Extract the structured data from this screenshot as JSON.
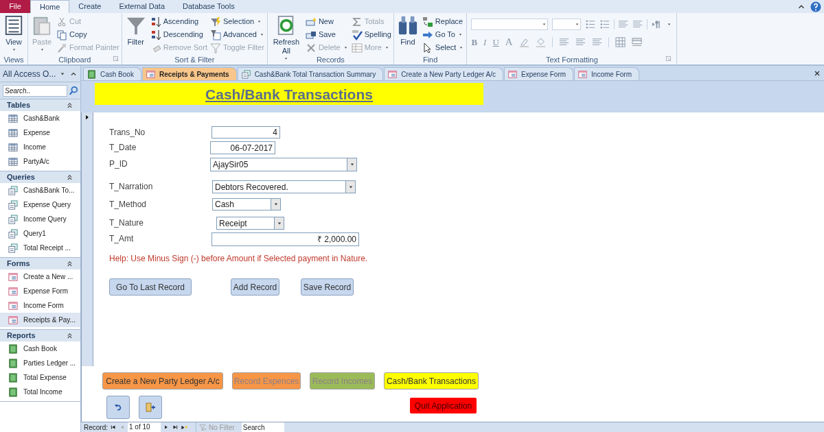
{
  "ribbon": {
    "tabs": [
      {
        "label": "File",
        "kind": "file",
        "selected": false
      },
      {
        "label": "Home",
        "kind": "tab",
        "selected": true
      },
      {
        "label": "Create",
        "kind": "tab",
        "selected": false
      },
      {
        "label": "External Data",
        "kind": "tab",
        "selected": false
      },
      {
        "label": "Database Tools",
        "kind": "tab",
        "selected": false
      }
    ],
    "groups": [
      {
        "label": "Views",
        "launcher": false,
        "columns": [
          {
            "kind": "large",
            "items": [
              {
                "label": "View",
                "disabled": false,
                "dropdown": true
              }
            ]
          }
        ]
      },
      {
        "label": "Clipboard",
        "launcher": true,
        "columns": [
          {
            "kind": "large",
            "items": [
              {
                "label": "Paste",
                "disabled": true,
                "dropdown": true
              }
            ]
          },
          {
            "kind": "small",
            "items": [
              {
                "label": "Cut",
                "disabled": true,
                "dropdown": false
              },
              {
                "label": "Copy",
                "disabled": false,
                "dropdown": false
              },
              {
                "label": "Format Painter",
                "disabled": true,
                "dropdown": false
              }
            ]
          }
        ]
      },
      {
        "label": "Sort & Filter",
        "launcher": false,
        "columns": [
          {
            "kind": "large",
            "items": [
              {
                "label": "Filter",
                "disabled": false,
                "dropdown": false
              }
            ]
          },
          {
            "kind": "small",
            "items": [
              {
                "label": "Ascending",
                "disabled": false,
                "dropdown": false
              },
              {
                "label": "Descending",
                "disabled": false,
                "dropdown": false
              },
              {
                "label": "Remove Sort",
                "disabled": true,
                "dropdown": false
              }
            ]
          },
          {
            "kind": "small",
            "items": [
              {
                "label": "Selection",
                "disabled": false,
                "dropdown": true
              },
              {
                "label": "Advanced",
                "disabled": false,
                "dropdown": true
              },
              {
                "label": "Toggle Filter",
                "disabled": true,
                "dropdown": false
              }
            ]
          }
        ]
      },
      {
        "label": "Records",
        "launcher": false,
        "columns": [
          {
            "kind": "large",
            "items": [
              {
                "label": "Refresh All",
                "disabled": false,
                "dropdown": true
              }
            ]
          },
          {
            "kind": "small",
            "items": [
              {
                "label": "New",
                "disabled": false,
                "dropdown": false
              },
              {
                "label": "Save",
                "disabled": false,
                "dropdown": false
              },
              {
                "label": "Delete",
                "disabled": true,
                "dropdown": true
              }
            ]
          },
          {
            "kind": "small",
            "items": [
              {
                "label": "Totals",
                "disabled": true,
                "dropdown": false
              },
              {
                "label": "Spelling",
                "disabled": false,
                "dropdown": false
              },
              {
                "label": "More",
                "disabled": true,
                "dropdown": true
              }
            ]
          }
        ]
      },
      {
        "label": "Find",
        "launcher": false,
        "columns": [
          {
            "kind": "large",
            "items": [
              {
                "label": "Find",
                "disabled": false,
                "dropdown": false
              }
            ]
          },
          {
            "kind": "small",
            "items": [
              {
                "label": "Replace",
                "disabled": false,
                "dropdown": false
              },
              {
                "label": "Go To",
                "disabled": false,
                "dropdown": true
              },
              {
                "label": "Select",
                "disabled": false,
                "dropdown": true
              }
            ]
          }
        ]
      }
    ],
    "text_formatting": {
      "label": "Text Formatting",
      "launcher": true,
      "bold": "B",
      "italic": "I",
      "underline": "U",
      "font_color": "A"
    }
  },
  "navigation_pane": {
    "header": "All Access O...",
    "search_placeholder": "Search..",
    "groups": [
      {
        "label": "Tables",
        "kind": "table",
        "expanded": true,
        "items": [
          {
            "label": "Cash&Bank",
            "selected": false
          },
          {
            "label": "Expense",
            "selected": false
          },
          {
            "label": "Income",
            "selected": false
          },
          {
            "label": "PartyA/c",
            "selected": false
          }
        ]
      },
      {
        "label": "Queries",
        "kind": "query",
        "expanded": true,
        "items": [
          {
            "label": "Cash&Bank To...",
            "selected": false
          },
          {
            "label": "Expense Query",
            "selected": false
          },
          {
            "label": "Income Query",
            "selected": false
          },
          {
            "label": "Query1",
            "selected": false
          },
          {
            "label": "Total Receipt ...",
            "selected": false
          }
        ]
      },
      {
        "label": "Forms",
        "kind": "form",
        "expanded": true,
        "items": [
          {
            "label": "Create a New ...",
            "selected": false
          },
          {
            "label": "Expense Form",
            "selected": false
          },
          {
            "label": "Income Form",
            "selected": false
          },
          {
            "label": "Receipts & Pay...",
            "selected": true
          }
        ]
      },
      {
        "label": "Reports",
        "kind": "report",
        "expanded": true,
        "items": [
          {
            "label": "Cash Book",
            "selected": false
          },
          {
            "label": "Parties Ledger ...",
            "selected": false
          },
          {
            "label": "Total Expense",
            "selected": false
          },
          {
            "label": "Total Income",
            "selected": false
          }
        ]
      }
    ]
  },
  "document_tabs": [
    {
      "label": "Cash Book",
      "kind": "report",
      "selected": false
    },
    {
      "label": "Receipts & Payments",
      "kind": "form",
      "selected": true
    },
    {
      "label": "Cash&Bank Total Transaction Summary",
      "kind": "query",
      "selected": false
    },
    {
      "label": "Create a New Party Ledger A/c",
      "kind": "form",
      "selected": false
    },
    {
      "label": "Expense Form",
      "kind": "form",
      "selected": false
    },
    {
      "label": "Income Form",
      "kind": "form",
      "selected": false
    }
  ],
  "form": {
    "title": "Cash/Bank Transactions",
    "fields": [
      {
        "label": "Trans_No",
        "kind": "number",
        "value": "4"
      },
      {
        "label": "T_Date",
        "kind": "number",
        "value": "06-07-2017"
      },
      {
        "label": "P_ID",
        "kind": "combo",
        "value": "AjaySir05"
      },
      {
        "label": "T_Narration",
        "kind": "combo",
        "value": "Debtors Recovered."
      },
      {
        "label": "T_Method",
        "kind": "combo",
        "value": "Cash"
      },
      {
        "label": "T_Nature",
        "kind": "combo",
        "value": "Receipt"
      },
      {
        "label": "T_Amt",
        "kind": "number",
        "value": "₹ 2,000.00"
      }
    ],
    "help": "Help: Use Minus Sign (-) before Amount if Selected payment in Nature.",
    "actions": [
      "Go To Last Record",
      "Add Record",
      "Save Record"
    ],
    "footer_buttons": [
      {
        "label": "Create a New Party Ledger A/c",
        "color": "#f79646",
        "disabled": false
      },
      {
        "label": "Record Expences",
        "color": "#f79646",
        "disabled": true
      },
      {
        "label": "Record Incomes",
        "color": "#9bbb59",
        "disabled": true
      },
      {
        "label": "Cash/Bank Transactions",
        "color": "#ffff00",
        "disabled": false
      }
    ],
    "quit_button": {
      "label": "Quit Application",
      "color": "#ff0000"
    }
  },
  "record_navigation": {
    "label": "Record:",
    "position": "1 of 10",
    "filter": "No Filter",
    "filter_active": false,
    "search_placeholder": "Search"
  }
}
